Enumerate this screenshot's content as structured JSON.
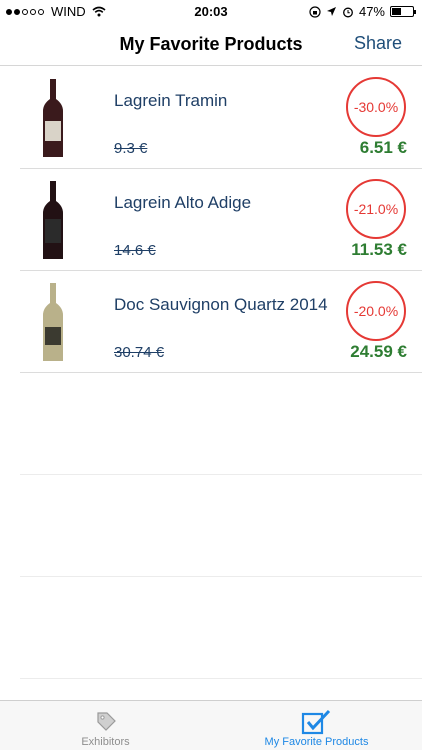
{
  "status_bar": {
    "carrier": "WIND",
    "time": "20:03",
    "battery": "47%",
    "battery_level": 0.47
  },
  "nav": {
    "title": "My Favorite Products",
    "share_label": "Share"
  },
  "products": [
    {
      "name": "Lagrein Tramin",
      "old_price": "9.3 €",
      "new_price": "6.51 €",
      "discount": "-30.0%",
      "bottle_color": "#3a1a1c",
      "label_color": "#d9d3c8"
    },
    {
      "name": "Lagrein Alto Adige",
      "old_price": "14.6 €",
      "new_price": "11.53 €",
      "discount": "-21.0%",
      "bottle_color": "#221114",
      "label_color": "#2b2b2b"
    },
    {
      "name": "Doc Sauvignon Quartz 2014",
      "old_price": "30.74 €",
      "new_price": "24.59 €",
      "discount": "-20.0%",
      "bottle_color": "#b9b18a",
      "label_color": "#3b3a30"
    }
  ],
  "tabs": [
    {
      "label": "Exhibitors",
      "icon": "tag-icon",
      "active": false
    },
    {
      "label": "My Favorite Products",
      "icon": "checkbox-icon",
      "active": true
    }
  ],
  "colors": {
    "accent": "#1e88e5",
    "price_green": "#2e7d32",
    "discount_red": "#e53935",
    "text_navy": "#1f3f66"
  }
}
